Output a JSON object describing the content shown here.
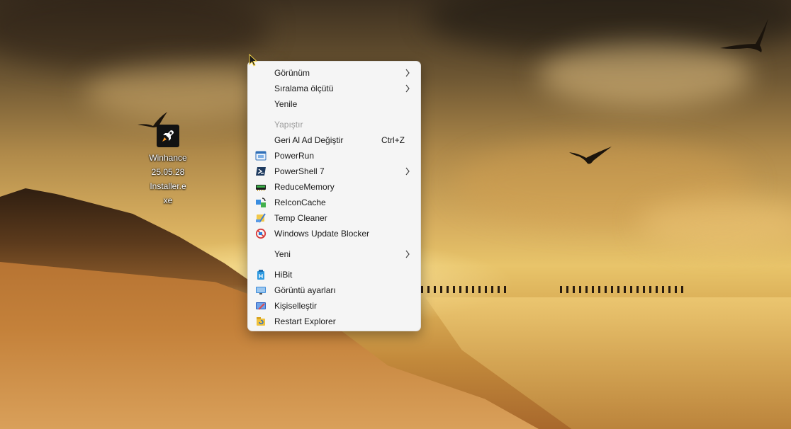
{
  "desktop": {
    "icon": {
      "name": "Winhance 25.05.28 Installer.exe",
      "label_lines": [
        "Winhance",
        "25.05.28",
        "Installer.e",
        "xe"
      ]
    }
  },
  "context_menu": {
    "items": [
      {
        "label": "Görünüm",
        "submenu": true,
        "icon": null
      },
      {
        "label": "Sıralama ölçütü",
        "submenu": true,
        "icon": null
      },
      {
        "label": "Yenile",
        "icon": null
      },
      {
        "label": "Yapıştır",
        "disabled": true,
        "icon": null
      },
      {
        "label": "Geri Al Ad Değiştir",
        "shortcut": "Ctrl+Z",
        "icon": null
      },
      {
        "label": "PowerRun",
        "icon": "powerrun-icon"
      },
      {
        "label": "PowerShell 7",
        "submenu": true,
        "icon": "powershell-icon"
      },
      {
        "label": "ReduceMemory",
        "icon": "memory-icon"
      },
      {
        "label": "ReIconCache",
        "icon": "icon-cache-icon"
      },
      {
        "label": "Temp Cleaner",
        "icon": "temp-cleaner-icon"
      },
      {
        "label": "Windows Update Blocker",
        "icon": "update-blocker-icon"
      },
      {
        "label": "Yeni",
        "submenu": true,
        "icon": null
      },
      {
        "label": "HiBit",
        "icon": "hibit-icon"
      },
      {
        "label": "Görüntü ayarları",
        "icon": "display-settings-icon"
      },
      {
        "label": "Kişiselleştir",
        "icon": "personalize-icon"
      },
      {
        "label": "Restart Explorer",
        "icon": "restart-explorer-icon"
      }
    ]
  },
  "colors": {
    "menu_bg": "#f5f5f5",
    "menu_text": "#1a1a1a",
    "disabled_text": "#9b9b9b"
  }
}
